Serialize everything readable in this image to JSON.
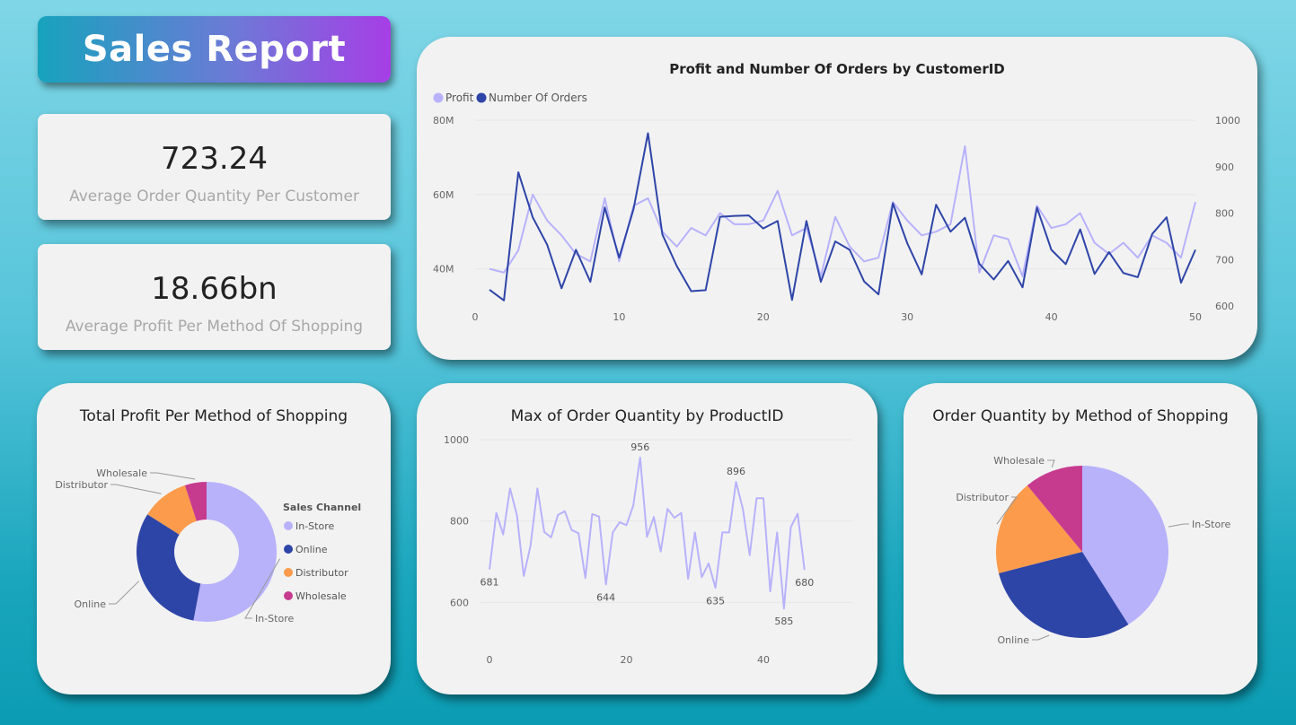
{
  "header": {
    "title": "Sales Report"
  },
  "kpis": [
    {
      "value": "723.24",
      "label": "Average Order Quantity Per Customer"
    },
    {
      "value": "18.66bn",
      "label": "Average Profit Per Method Of Shopping"
    }
  ],
  "colors": {
    "profit": "#b8b2fb",
    "orders": "#2e45a8",
    "in_store": "#b8b2fb",
    "online": "#2e45a8",
    "distributor": "#fb9b4b",
    "wholesale": "#c73b8f"
  },
  "chart_data": [
    {
      "type": "line",
      "title": "Profit and Number Of Orders by CustomerID",
      "legend": [
        "Profit",
        "Number Of Orders"
      ],
      "legend_position": "top-left",
      "x": [
        1,
        2,
        3,
        4,
        5,
        6,
        7,
        8,
        9,
        10,
        11,
        12,
        13,
        14,
        15,
        16,
        17,
        18,
        19,
        20,
        21,
        22,
        23,
        24,
        25,
        26,
        27,
        28,
        29,
        30,
        31,
        32,
        33,
        34,
        35,
        36,
        37,
        38,
        39,
        40,
        41,
        42,
        43,
        44,
        45,
        46,
        47,
        48,
        49,
        50
      ],
      "xlim": [
        0,
        50
      ],
      "x_ticks": [
        "0",
        "10",
        "20",
        "30",
        "40",
        "50"
      ],
      "y_ticks_left": [
        "40M",
        "60M",
        "80M"
      ],
      "y_ticks_right": [
        "600",
        "700",
        "800",
        "900",
        "1000"
      ],
      "ylim_left": [
        30,
        80
      ],
      "ylim_right": [
        600,
        1000
      ],
      "series": [
        {
          "name": "Profit",
          "axis": "left",
          "values": [
            40,
            39,
            45,
            60,
            53,
            49,
            44,
            42,
            59,
            42,
            57,
            59,
            50,
            46,
            51,
            49,
            55,
            52,
            52,
            53,
            61,
            49,
            51,
            38,
            54,
            46,
            42,
            43,
            58,
            53,
            49,
            50,
            52,
            73,
            39,
            49,
            48,
            38,
            57,
            51,
            52,
            55,
            47,
            44,
            47,
            43,
            49,
            47,
            43,
            58
          ]
        },
        {
          "name": "Number Of Orders",
          "axis": "right",
          "values": [
            635,
            612,
            888,
            791,
            732,
            638,
            721,
            652,
            812,
            704,
            809,
            972,
            754,
            686,
            632,
            634,
            792,
            794,
            795,
            767,
            783,
            613,
            783,
            652,
            739,
            721,
            653,
            625,
            821,
            735,
            668,
            818,
            760,
            790,
            691,
            657,
            697,
            640,
            812,
            721,
            690,
            765,
            669,
            716,
            671,
            662,
            755,
            791,
            650,
            721
          ]
        }
      ]
    },
    {
      "type": "pie",
      "title": "Total Profit Per Method of Shopping",
      "donut": true,
      "legend_title": "Sales Channel",
      "legend": [
        "In-Store",
        "Online",
        "Distributor",
        "Wholesale"
      ],
      "legend_position": "right",
      "categories": [
        "In-Store",
        "Online",
        "Distributor",
        "Wholesale"
      ],
      "values": [
        53,
        31,
        11,
        5
      ]
    },
    {
      "type": "line",
      "title": "Max of Order Quantity by ProductID",
      "x_ticks": [
        "0",
        "20",
        "40"
      ],
      "xlim": [
        0,
        48
      ],
      "y_ticks": [
        "600",
        "800",
        "1000"
      ],
      "ylim": [
        570,
        1000
      ],
      "x": [
        0,
        1,
        2,
        3,
        4,
        5,
        6,
        7,
        8,
        9,
        10,
        11,
        12,
        13,
        14,
        15,
        16,
        17,
        18,
        19,
        20,
        21,
        22,
        23,
        24,
        25,
        26,
        27,
        28,
        29,
        30,
        31,
        32,
        33,
        34,
        35,
        36,
        37,
        38,
        39,
        40,
        41,
        42,
        43,
        44,
        45,
        46,
        47,
        48
      ],
      "series": [
        {
          "name": "",
          "values": [
            681,
            820,
            767,
            880,
            815,
            665,
            740,
            880,
            773,
            760,
            815,
            824,
            778,
            770,
            660,
            817,
            811,
            644,
            772,
            797,
            790,
            838,
            956,
            761,
            810,
            725,
            830,
            808,
            820,
            658,
            772,
            662,
            696,
            636,
            772,
            772,
            896,
            830,
            716,
            856,
            856,
            627,
            772,
            585,
            785,
            818,
            680
          ]
        }
      ],
      "data_labels": [
        {
          "x": 0,
          "y": 681,
          "label": "681"
        },
        {
          "x": 17,
          "y": 644,
          "label": "644"
        },
        {
          "x": 22,
          "y": 956,
          "label": "956"
        },
        {
          "x": 33,
          "y": 635,
          "label": "635"
        },
        {
          "x": 36,
          "y": 896,
          "label": "896"
        },
        {
          "x": 43,
          "y": 585,
          "label": "585"
        },
        {
          "x": 46,
          "y": 680,
          "label": "680"
        }
      ]
    },
    {
      "type": "pie",
      "title": "Order Quantity by Method of Shopping",
      "donut": false,
      "categories": [
        "In-Store",
        "Online",
        "Distributor",
        "Wholesale"
      ],
      "values": [
        41,
        30,
        18,
        11
      ]
    }
  ]
}
